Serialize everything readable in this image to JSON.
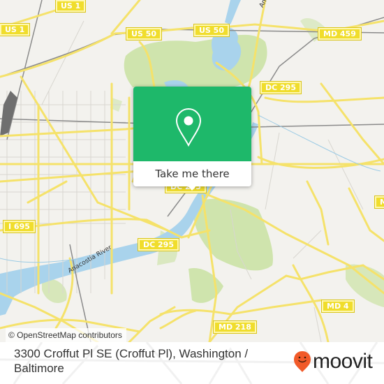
{
  "map": {
    "road_shields": [
      {
        "label": "US 1"
      },
      {
        "label": "US 1"
      },
      {
        "label": "US 50"
      },
      {
        "label": "US 50"
      },
      {
        "label": "MD 459"
      },
      {
        "label": "DC 295"
      },
      {
        "label": "DC 295"
      },
      {
        "label": "DC 295"
      },
      {
        "label": "I 695"
      },
      {
        "label": "MD 4"
      },
      {
        "label": "MD 218"
      },
      {
        "label": "M"
      }
    ],
    "water_labels": [
      {
        "label": "Anacostia River"
      },
      {
        "label": "Anacostia River"
      }
    ],
    "attribution": "© OpenStreetMap contributors",
    "colors": {
      "background": "#f3f2ee",
      "road": "#f5e26a",
      "park": "#cfe4ad",
      "water": "#a9d3ec",
      "rail": "#8a8a8a"
    }
  },
  "popup": {
    "icon": "location-pin-icon",
    "button_label": "Take me there",
    "accent_color": "#1eb86a"
  },
  "footer": {
    "address": "3300 Croffut Pl SE (Croffut Pl), Washington / Baltimore",
    "brand": "moovit",
    "brand_icon": "moovit-smiley-pin-icon",
    "brand_color": "#f15a29"
  }
}
